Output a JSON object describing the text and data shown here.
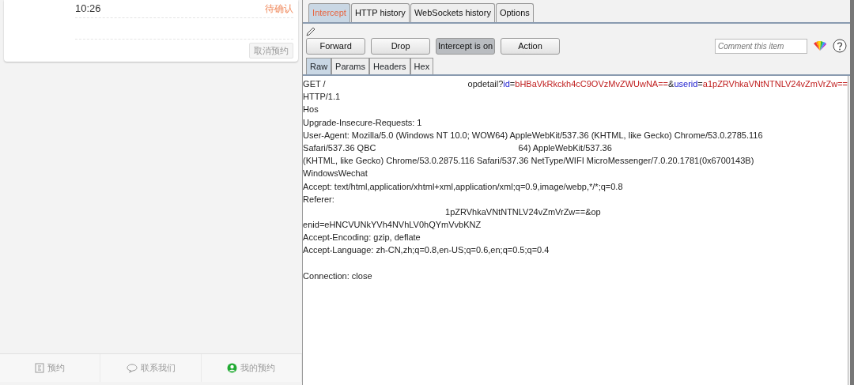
{
  "booking_card": {
    "time": "10:26",
    "status": "待确认",
    "cancel_button": "取消预约"
  },
  "bottom_nav": [
    {
      "label": "预约",
      "kind": "form",
      "selected": false
    },
    {
      "label": "联系我们",
      "kind": "chat",
      "selected": false
    },
    {
      "label": "我的预约",
      "kind": "person",
      "selected": true
    }
  ],
  "proxy_tabs": [
    {
      "label": "Intercept",
      "selected": true
    },
    {
      "label": "HTTP history",
      "selected": false
    },
    {
      "label": "WebSockets history",
      "selected": false
    },
    {
      "label": "Options",
      "selected": false
    }
  ],
  "buttons": [
    {
      "label": "Forward",
      "pressed": false
    },
    {
      "label": "Drop",
      "pressed": false
    },
    {
      "label": "Intercept is on",
      "pressed": true
    },
    {
      "label": "Action",
      "pressed": false
    }
  ],
  "comment": {
    "placeholder": "Comment this item"
  },
  "message_tabs": [
    {
      "label": "Raw",
      "selected": true
    },
    {
      "label": "Params",
      "selected": false
    },
    {
      "label": "Headers",
      "selected": false
    },
    {
      "label": "Hex",
      "selected": false
    }
  ],
  "request_lines": [
    [
      {
        "kind": "plain",
        "text": "GET /"
      },
      {
        "kind": "gap"
      },
      {
        "kind": "plain",
        "text": "opdetail?"
      },
      {
        "kind": "name",
        "text": "id"
      },
      {
        "kind": "plain",
        "text": "="
      },
      {
        "kind": "value",
        "text": "bHBaVkRkckh4cC9OVzMvZWUwNA=="
      },
      {
        "kind": "plain",
        "text": "&"
      },
      {
        "kind": "name",
        "text": "userid"
      },
      {
        "kind": "plain",
        "text": "="
      },
      {
        "kind": "value",
        "text": "a1pZRVhkaVNtNTNLV24vZmVrZw=="
      }
    ],
    [
      {
        "kind": "plain",
        "text": "HTTP/1.1"
      }
    ],
    [
      {
        "kind": "plain",
        "text": "Hos"
      }
    ],
    [
      {
        "kind": "plain",
        "text": "Upgrade-Insecure-Requests: 1"
      }
    ],
    [
      {
        "kind": "plain",
        "text": "User-Agent: Mozilla/5.0 (Windows NT 10.0; WOW64) AppleWebKit/537.36 (KHTML, like Gecko) Chrome/53.0.2785.116"
      }
    ],
    [
      {
        "kind": "plain",
        "text": "Safari/537.36 QBC"
      },
      {
        "kind": "gap"
      },
      {
        "kind": "plain",
        "text": "64) AppleWebKit/537.36"
      }
    ],
    [
      {
        "kind": "plain",
        "text": "(KHTML, like Gecko) Chrome/53.0.2875.116 Safari/537.36 NetType/WIFI MicroMessenger/7.0.20.1781(0x6700143B)"
      }
    ],
    [
      {
        "kind": "plain",
        "text": "WindowsWechat"
      }
    ],
    [
      {
        "kind": "plain",
        "text": "Accept: text/html,application/xhtml+xml,application/xml;q=0.9,image/webp,*/*;q=0.8"
      }
    ],
    [
      {
        "kind": "plain",
        "text": "Referer:"
      }
    ],
    [
      {
        "kind": "gap"
      },
      {
        "kind": "plain",
        "text": "1pZRVhkaVNtNTNLV24vZmVrZw==&op"
      }
    ],
    [
      {
        "kind": "plain",
        "text": "enid=eHNCVUNkYVh4NVhLV0hQYmVvbKNZ"
      }
    ],
    [
      {
        "kind": "plain",
        "text": "Accept-Encoding: gzip, deflate"
      }
    ],
    [
      {
        "kind": "plain",
        "text": "Accept-Language: zh-CN,zh;q=0.8,en-US;q=0.6,en;q=0.5;q=0.4"
      }
    ],
    [
      {
        "kind": "gap"
      }
    ],
    [
      {
        "kind": "plain",
        "text": "Connection: close"
      }
    ]
  ]
}
